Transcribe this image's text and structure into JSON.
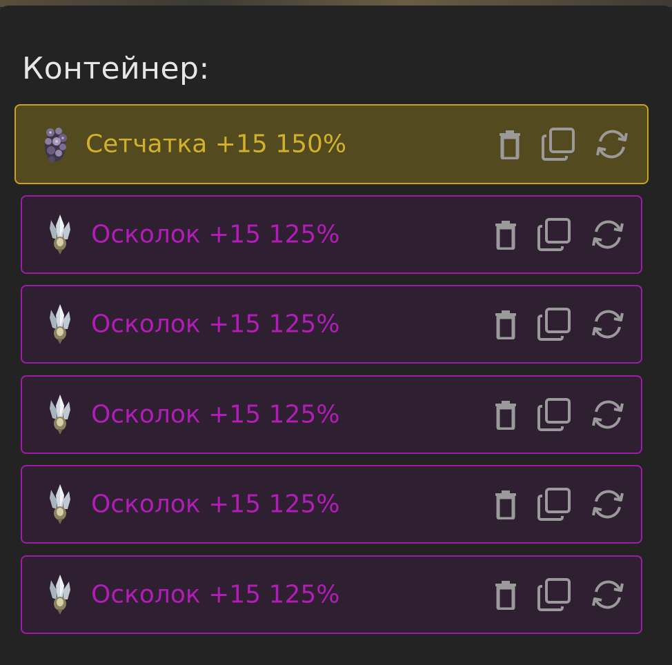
{
  "panel": {
    "title": "Контейнер:"
  },
  "colors": {
    "gold_accent": "#c9a51e",
    "gold_text": "#d2b12a",
    "purple_accent": "#a11ba9",
    "purple_text": "#b21cb7",
    "icon": "#9a9a9a"
  },
  "items": [
    {
      "name": "Сетчатка +15 150%",
      "rarity": "gold",
      "thumb_icon": "retina-cluster-icon"
    },
    {
      "name": "Осколок +15 125%",
      "rarity": "purple",
      "thumb_icon": "crystal-shard-icon"
    },
    {
      "name": "Осколок +15 125%",
      "rarity": "purple",
      "thumb_icon": "crystal-shard-icon"
    },
    {
      "name": "Осколок +15 125%",
      "rarity": "purple",
      "thumb_icon": "crystal-shard-icon"
    },
    {
      "name": "Осколок +15 125%",
      "rarity": "purple",
      "thumb_icon": "crystal-shard-icon"
    },
    {
      "name": "Осколок +15 125%",
      "rarity": "purple",
      "thumb_icon": "crystal-shard-icon"
    }
  ],
  "actions": [
    "trash-icon",
    "copy-icon",
    "swap-icon"
  ]
}
